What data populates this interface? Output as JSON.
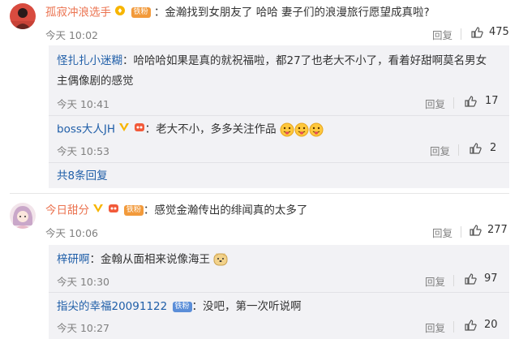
{
  "comments": [
    {
      "user": "孤寂冲浪选手",
      "badge": "铁粉",
      "text": "金瀚找到女朋友了 哈哈 妻子们的浪漫旅行愿望成真啦?",
      "time": "今天 10:02",
      "reply_label": "回复",
      "likes": "475",
      "replies": [
        {
          "user": "怪扎扎小迷糊",
          "text_line1": "哈哈哈如果是真的就祝福啦，都27了也老大不小了，看着好甜啊莫名男女",
          "text_line2": "主偶像剧的感觉",
          "time": "今天 10:41",
          "reply_label": "回复",
          "likes": "17"
        },
        {
          "user": "boss大人JH",
          "text": "老大不小，多多关注作品",
          "time": "今天 10:53",
          "reply_label": "回复",
          "likes": "2"
        }
      ],
      "more_replies": "共8条回复"
    },
    {
      "user": "今日甜分",
      "text": "感觉金瀚传出的绯闻真的太多了",
      "time": "今天 10:06",
      "reply_label": "回复",
      "likes": "277",
      "replies": [
        {
          "user": "梓研啊",
          "text": "金翰从面相来说像海王",
          "time": "今天 10:30",
          "reply_label": "回复",
          "likes": "97"
        },
        {
          "user": "指尖的幸福20091122",
          "badge": "铁粉",
          "text": "没吧，第一次听说啊",
          "time": "今天 10:27",
          "reply_label": "回复",
          "likes": "20"
        }
      ]
    }
  ],
  "colors": {
    "name_orange": "#eb7350",
    "name_blue": "#1f5ea8",
    "sub_bg": "#f2f2f5",
    "muted": "#808080"
  }
}
